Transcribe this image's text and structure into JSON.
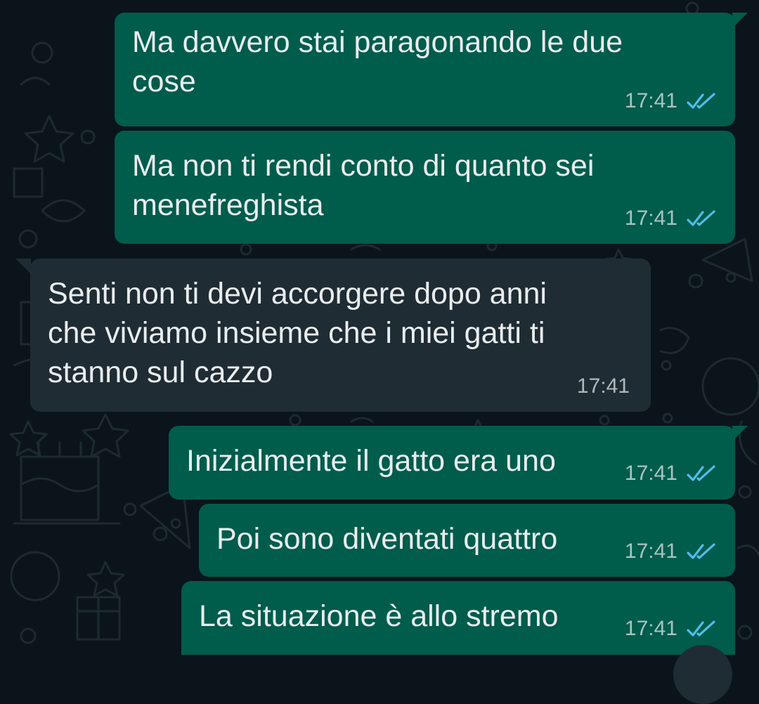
{
  "chat": {
    "colors": {
      "background": "#0b141a",
      "outgoing_bubble": "#005c4b",
      "incoming_bubble": "#202c33",
      "text": "#e9edef",
      "read_ticks": "#53bdeb"
    },
    "messages": [
      {
        "direction": "outgoing",
        "text": "Ma davvero stai paragonando le due\ncose",
        "time": "17:41",
        "status": "read"
      },
      {
        "direction": "outgoing",
        "text": "Ma non ti rendi conto di quanto sei\nmenefreghista",
        "time": "17:41",
        "status": "read"
      },
      {
        "direction": "incoming",
        "text": "Senti non ti devi accorgere dopo anni\nche viviamo insieme che i miei gatti ti\nstanno sul cazzo",
        "time": "17:41"
      },
      {
        "direction": "outgoing",
        "text": "Inizialmente il gatto era uno",
        "time": "17:41",
        "status": "read"
      },
      {
        "direction": "outgoing",
        "text": "Poi sono diventati quattro",
        "time": "17:41",
        "status": "read"
      },
      {
        "direction": "outgoing",
        "text": "La situazione è allo stremo",
        "time": "17:41",
        "status": "read"
      }
    ]
  }
}
